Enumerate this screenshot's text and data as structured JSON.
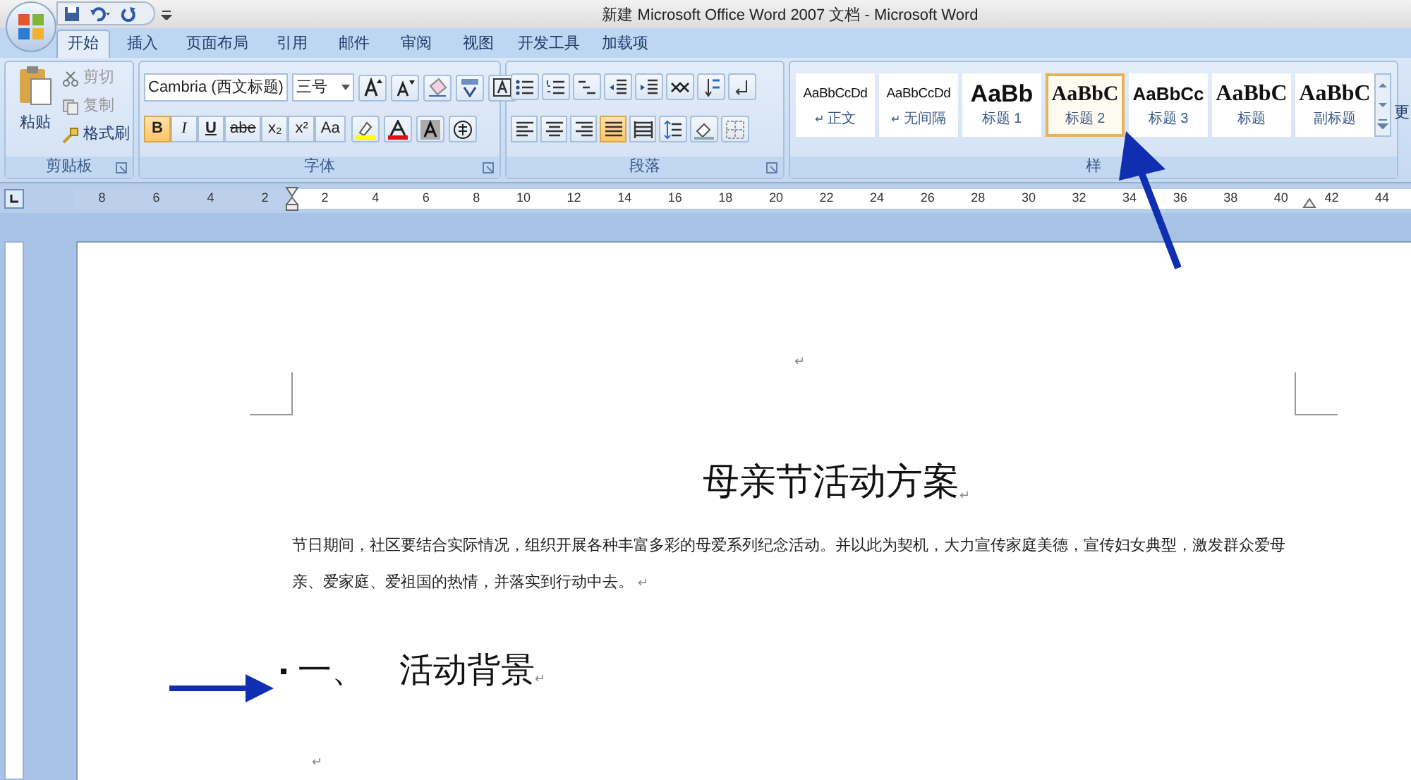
{
  "window": {
    "title": "新建 Microsoft Office Word 2007 文档 - Microsoft Word"
  },
  "tabs": [
    {
      "label": "开始",
      "selected": true
    },
    {
      "label": "插入",
      "selected": false
    },
    {
      "label": "页面布局",
      "selected": false
    },
    {
      "label": "引用",
      "selected": false
    },
    {
      "label": "邮件",
      "selected": false
    },
    {
      "label": "审阅",
      "selected": false
    },
    {
      "label": "视图",
      "selected": false
    },
    {
      "label": "开发工具",
      "selected": false
    },
    {
      "label": "加载项",
      "selected": false
    }
  ],
  "clipboard": {
    "paste": "粘贴",
    "cut": "剪切",
    "copy": "复制",
    "format_painter": "格式刷",
    "label": "剪贴板"
  },
  "font": {
    "font_name": "Cambria (西文标题)",
    "font_size": "三号",
    "label": "字体",
    "format_buttons": [
      {
        "label": "B",
        "selected": true
      },
      {
        "label": "I",
        "selected": false
      },
      {
        "label": "U",
        "selected": false
      },
      {
        "label": "abe",
        "selected": false
      },
      {
        "label": "x₂",
        "selected": false
      },
      {
        "label": "x²",
        "selected": false
      },
      {
        "label": "Aa",
        "selected": false
      }
    ]
  },
  "paragraph": {
    "label": "段落",
    "align_buttons": [
      {
        "kind": "left",
        "selected": false
      },
      {
        "kind": "center",
        "selected": false
      },
      {
        "kind": "right",
        "selected": false
      },
      {
        "kind": "justify",
        "selected": true
      },
      {
        "kind": "distributed",
        "selected": false
      }
    ]
  },
  "styles": {
    "label": "样",
    "more": "更",
    "items": [
      {
        "kind": "normal",
        "sample": "AaBbCcDd",
        "name": "正文",
        "mark": "↵",
        "selected": false
      },
      {
        "kind": "normal",
        "sample": "AaBbCcDd",
        "name": "无间隔",
        "mark": "↵",
        "selected": false
      },
      {
        "kind": "heading1",
        "sample": "AaBb",
        "name": "标题 1",
        "selected": false
      },
      {
        "kind": "heading2",
        "sample": "AaBbC",
        "name": "标题 2",
        "selected": true
      },
      {
        "kind": "heading3",
        "sample": "AaBbCc",
        "name": "标题 3",
        "selected": false
      },
      {
        "kind": "title",
        "sample": "AaBbC",
        "name": "标题",
        "selected": false
      },
      {
        "kind": "subtitle",
        "sample": "AaBbC",
        "name": "副标题",
        "selected": false
      }
    ]
  },
  "ruler": {
    "left_numbers": [
      "8",
      "6",
      "4",
      "2"
    ],
    "right_numbers": [
      "2",
      "4",
      "6",
      "8",
      "10",
      "12",
      "14",
      "16",
      "18",
      "20",
      "22",
      "24",
      "26",
      "28",
      "30",
      "32",
      "34",
      "36",
      "38",
      "40",
      "42",
      "44"
    ]
  },
  "document": {
    "top_mark": "↵",
    "title": "母亲节活动方案",
    "title_mark": "↵",
    "body": "节日期间，社区要结合实际情况，组织开展各种丰富多彩的母爱系列纪念活动。并以此为契机，大力宣传家庭美德，宣传妇女典型，激发群众爱母亲、爱家庭、爱祖国的热情，并落实到行动中去。",
    "body_mark": "↵",
    "heading_number": "一、",
    "heading": "活动背景",
    "heading_mark": "↵",
    "bottom_mark": "↵"
  }
}
